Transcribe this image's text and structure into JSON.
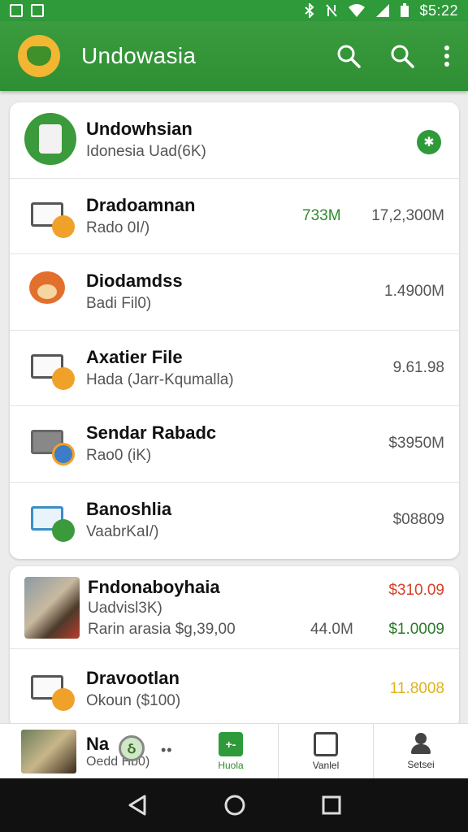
{
  "status_bar": {
    "time": "$5:22"
  },
  "app_bar": {
    "title": "Undowasia",
    "icons": [
      "app-logo-icon",
      "search-icon",
      "search-icon",
      "more-vert-icon"
    ]
  },
  "list_main": [
    {
      "title": "Undowhsian",
      "subtitle": "Idonesia Uad(6K)",
      "value_1": "",
      "value_2": "",
      "icon": "globe-icon"
    },
    {
      "title": "Dradoamnan",
      "subtitle": "Rado 0I/)",
      "value_1": "733M",
      "value_2": "17,2,300M",
      "icon": "monitor-icon"
    },
    {
      "title": "Diodamdss",
      "subtitle": "Badi Fil0)",
      "value_1": "",
      "value_2": "1.4900M",
      "icon": "fox-icon"
    },
    {
      "title": "Axatier File",
      "subtitle": "Hada (Jarr-Kqumalla)",
      "value_1": "",
      "value_2": "9.61.98",
      "icon": "monitor-icon"
    },
    {
      "title": "Sendar Rabadc",
      "subtitle": "Rao0 (iK)",
      "value_1": "",
      "value_2": "$3950M",
      "icon": "desk-icon"
    },
    {
      "title": "Banoshlia",
      "subtitle": "VaabrKaI/)",
      "value_1": "",
      "value_2": "$08809",
      "icon": "monitor-icon"
    }
  ],
  "list_secondary": [
    {
      "title": "Fndonaboyhaia",
      "subtitle_1": "Uadvisl3K)",
      "subtitle_2": "Rarin arasia $g,39,00",
      "value_mid": "44.0M",
      "value_top": "$310.09",
      "value_bottom": "$1.0009"
    },
    {
      "title": "Dravootlan",
      "subtitle": "Okoun ($100)",
      "value": "11.8008"
    }
  ],
  "mini_player": {
    "title": "Na",
    "subtitle": "Oedd Hb0)",
    "logo_glyph": "ઠ",
    "dots": "••"
  },
  "bottom_nav": [
    {
      "label": "Huola",
      "icon": "plus-minus-icon",
      "active": true
    },
    {
      "label": "Vanlel",
      "icon": "wallet-icon",
      "active": false
    },
    {
      "label": "Setsei",
      "icon": "person-icon",
      "active": false
    }
  ],
  "colors": {
    "brand_green": "#2e9a3a",
    "accent_orange": "#f0a12a",
    "value_red": "#d8402a",
    "value_yellow": "#e0b21a"
  }
}
